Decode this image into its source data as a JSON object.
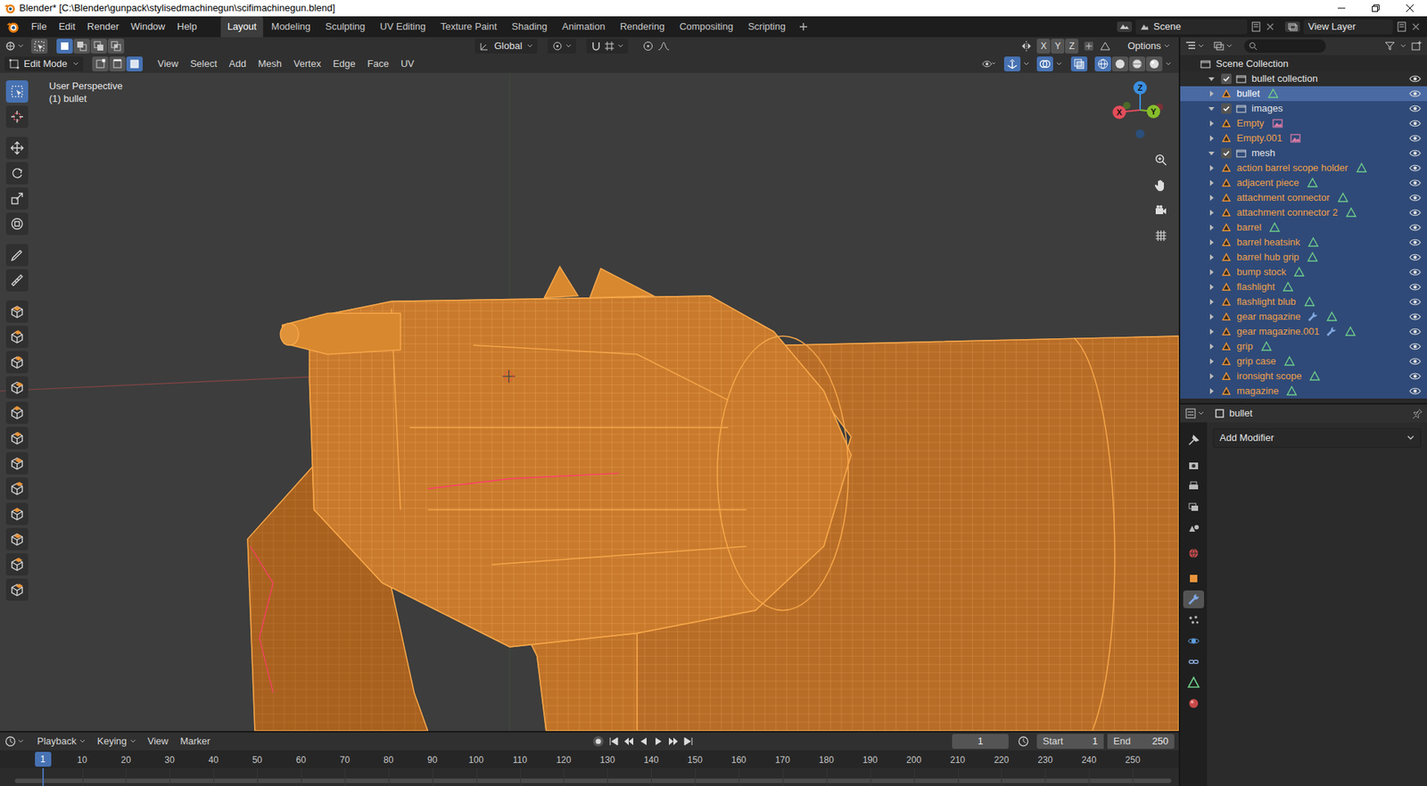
{
  "window": {
    "title": "Blender* [C:\\Blender\\gunpack\\stylisedmachinegun\\scifimachinegun.blend]"
  },
  "menu": [
    "File",
    "Edit",
    "Render",
    "Window",
    "Help"
  ],
  "workspaces": [
    {
      "label": "Layout",
      "selected": true
    },
    {
      "label": "Modeling",
      "selected": false
    },
    {
      "label": "Sculpting",
      "selected": false
    },
    {
      "label": "UV Editing",
      "selected": false
    },
    {
      "label": "Texture Paint",
      "selected": false
    },
    {
      "label": "Shading",
      "selected": false
    },
    {
      "label": "Animation",
      "selected": false
    },
    {
      "label": "Rendering",
      "selected": false
    },
    {
      "label": "Compositing",
      "selected": false
    },
    {
      "label": "Scripting",
      "selected": false
    }
  ],
  "scene": "Scene",
  "view_layer": "View Layer",
  "tool_settings": {
    "orientation": "Global",
    "options": "Options",
    "mirror": [
      {
        "label": "X",
        "on": false
      },
      {
        "label": "Y",
        "on": false
      },
      {
        "label": "Z",
        "on": false
      }
    ]
  },
  "view_header": {
    "mode": "Edit Mode",
    "select_modes": [
      {
        "kind": "vertex",
        "selected": false
      },
      {
        "kind": "edge",
        "selected": false
      },
      {
        "kind": "face",
        "selected": true
      }
    ],
    "menus": [
      "View",
      "Select",
      "Add",
      "Mesh",
      "Vertex",
      "Edge",
      "Face",
      "UV"
    ],
    "xray": true,
    "shading": [
      {
        "kind": "wireframe",
        "selected": true
      },
      {
        "kind": "solid",
        "selected": false
      },
      {
        "kind": "material",
        "selected": false
      },
      {
        "kind": "rendered",
        "selected": false
      }
    ]
  },
  "viewport": {
    "info": [
      "User Perspective",
      "(1) bullet"
    ]
  },
  "gizmo": [
    {
      "label": "X",
      "color": "#e34d5a"
    },
    {
      "label": "Y",
      "color": "#86bd2b"
    },
    {
      "label": "Z",
      "color": "#3b8fe0"
    }
  ],
  "tools": [
    {
      "selected": true
    },
    {
      "selected": false
    },
    {
      "selected": false
    },
    {
      "selected": false
    },
    {
      "selected": false
    },
    {
      "selected": false
    },
    {
      "selected": false
    },
    {
      "selected": false
    },
    {
      "selected": false
    },
    {
      "selected": false
    },
    {
      "selected": false
    },
    {
      "selected": false
    },
    {
      "selected": false
    },
    {
      "selected": false
    },
    {
      "selected": false
    },
    {
      "selected": false
    },
    {
      "selected": false
    },
    {
      "selected": false
    },
    {
      "selected": false
    },
    {
      "selected": false
    }
  ],
  "outliner": {
    "rows": [
      {
        "name": "Scene Collection",
        "kind": "scene",
        "depth": 0,
        "expanded": true,
        "checked": false,
        "selected": false,
        "active": false,
        "visible": false,
        "has_modifiers": false
      },
      {
        "name": "bullet collection",
        "kind": "collection",
        "depth": 1,
        "expanded": true,
        "checked": true,
        "selected": false,
        "active": false,
        "visible": true,
        "has_modifiers": false
      },
      {
        "name": "bullet",
        "kind": "mesh",
        "depth": 2,
        "expanded": false,
        "checked": false,
        "selected": true,
        "active": true,
        "visible": true,
        "has_modifiers": false
      },
      {
        "name": "images",
        "kind": "collection",
        "depth": 1,
        "expanded": true,
        "checked": true,
        "selected": true,
        "active": false,
        "visible": true,
        "has_modifiers": false
      },
      {
        "name": "Empty",
        "kind": "empty",
        "depth": 2,
        "expanded": false,
        "checked": false,
        "selected": true,
        "active": false,
        "visible": true,
        "has_modifiers": false
      },
      {
        "name": "Empty.001",
        "kind": "empty",
        "depth": 2,
        "expanded": false,
        "checked": false,
        "selected": true,
        "active": false,
        "visible": true,
        "has_modifiers": false
      },
      {
        "name": "mesh",
        "kind": "collection",
        "depth": 1,
        "expanded": true,
        "checked": true,
        "selected": true,
        "active": false,
        "visible": true,
        "has_modifiers": false
      },
      {
        "name": "action barrel scope holder",
        "kind": "mesh",
        "depth": 2,
        "expanded": false,
        "checked": false,
        "selected": true,
        "active": false,
        "visible": true,
        "has_modifiers": false
      },
      {
        "name": "adjacent piece",
        "kind": "mesh",
        "depth": 2,
        "expanded": false,
        "checked": false,
        "selected": true,
        "active": false,
        "visible": true,
        "has_modifiers": false
      },
      {
        "name": "attachment connector",
        "kind": "mesh",
        "depth": 2,
        "expanded": false,
        "checked": false,
        "selected": true,
        "active": false,
        "visible": true,
        "has_modifiers": false
      },
      {
        "name": "attachment connector 2",
        "kind": "mesh",
        "depth": 2,
        "expanded": false,
        "checked": false,
        "selected": true,
        "active": false,
        "visible": true,
        "has_modifiers": false
      },
      {
        "name": "barrel",
        "kind": "mesh",
        "depth": 2,
        "expanded": false,
        "checked": false,
        "selected": true,
        "active": false,
        "visible": true,
        "has_modifiers": false
      },
      {
        "name": "barrel heatsink",
        "kind": "mesh",
        "depth": 2,
        "expanded": false,
        "checked": false,
        "selected": true,
        "active": false,
        "visible": true,
        "has_modifiers": false
      },
      {
        "name": "barrel hub grip",
        "kind": "mesh",
        "depth": 2,
        "expanded": false,
        "checked": false,
        "selected": true,
        "active": false,
        "visible": true,
        "has_modifiers": false
      },
      {
        "name": "bump stock",
        "kind": "mesh",
        "depth": 2,
        "expanded": false,
        "checked": false,
        "selected": true,
        "active": false,
        "visible": true,
        "has_modifiers": false
      },
      {
        "name": "flashlight",
        "kind": "mesh",
        "depth": 2,
        "expanded": false,
        "checked": false,
        "selected": true,
        "active": false,
        "visible": true,
        "has_modifiers": false
      },
      {
        "name": "flashlight blub",
        "kind": "mesh",
        "depth": 2,
        "expanded": false,
        "checked": false,
        "selected": true,
        "active": false,
        "visible": true,
        "has_modifiers": false
      },
      {
        "name": "gear magazine",
        "kind": "mesh",
        "depth": 2,
        "expanded": false,
        "checked": false,
        "selected": true,
        "active": false,
        "visible": true,
        "has_modifiers": true
      },
      {
        "name": "gear magazine.001",
        "kind": "mesh",
        "depth": 2,
        "expanded": false,
        "checked": false,
        "selected": true,
        "active": false,
        "visible": true,
        "has_modifiers": true
      },
      {
        "name": "grip",
        "kind": "mesh",
        "depth": 2,
        "expanded": false,
        "checked": false,
        "selected": true,
        "active": false,
        "visible": true,
        "has_modifiers": false
      },
      {
        "name": "grip case",
        "kind": "mesh",
        "depth": 2,
        "expanded": false,
        "checked": false,
        "selected": true,
        "active": false,
        "visible": true,
        "has_modifiers": false
      },
      {
        "name": "ironsight scope",
        "kind": "mesh",
        "depth": 2,
        "expanded": false,
        "checked": false,
        "selected": true,
        "active": false,
        "visible": true,
        "has_modifiers": false
      },
      {
        "name": "magazine",
        "kind": "mesh",
        "depth": 2,
        "expanded": false,
        "checked": false,
        "selected": true,
        "active": false,
        "visible": true,
        "has_modifiers": false
      }
    ]
  },
  "properties": {
    "object": "bullet",
    "add_modifier": "Add Modifier",
    "tabs": [
      {
        "kind": "tool",
        "selected": false
      },
      {
        "kind": "render",
        "selected": false
      },
      {
        "kind": "output",
        "selected": false
      },
      {
        "kind": "view_layer",
        "selected": false
      },
      {
        "kind": "scene",
        "selected": false
      },
      {
        "kind": "world",
        "selected": false
      },
      {
        "kind": "object",
        "selected": false
      },
      {
        "kind": "modifier",
        "selected": true
      },
      {
        "kind": "particles",
        "selected": false
      },
      {
        "kind": "physics",
        "selected": false
      },
      {
        "kind": "constraints",
        "selected": false
      },
      {
        "kind": "data",
        "selected": false
      },
      {
        "kind": "material",
        "selected": false
      }
    ]
  },
  "timeline": {
    "menus": [
      {
        "label": "Playback",
        "dropdown": true
      },
      {
        "label": "Keying",
        "dropdown": true
      },
      {
        "label": "View",
        "dropdown": false
      },
      {
        "label": "Marker",
        "dropdown": false
      }
    ],
    "frame": "1",
    "start_label": "Start",
    "start": "1",
    "end_label": "End",
    "end": "250",
    "current": "1",
    "ruler": [
      "10",
      "20",
      "30",
      "40",
      "50",
      "60",
      "70",
      "80",
      "90",
      "100",
      "110",
      "120",
      "130",
      "140",
      "150",
      "160",
      "170",
      "180",
      "190",
      "200",
      "210",
      "220",
      "230",
      "240",
      "250"
    ]
  }
}
